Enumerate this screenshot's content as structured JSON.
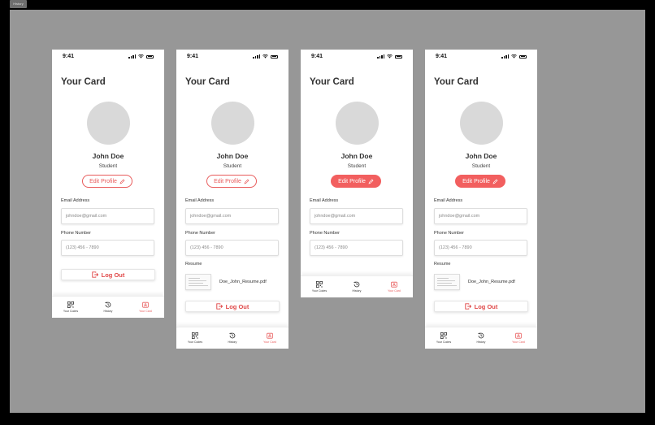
{
  "tab_label": "History",
  "phones": [
    {
      "time": "9:41",
      "title": "Your Card",
      "name": "John Doe",
      "role": "Student",
      "edit_label": "Edit Profile",
      "edit_filled": false,
      "email_label": "Email Address",
      "email_placeholder": "johndoe@gmail.com",
      "phone_label": "Phone Number",
      "phone_placeholder": "(123) 456 - 7890",
      "has_resume": false,
      "logout_label": "Log Out",
      "nav": [
        "Your Codes",
        "History",
        "Your Card"
      ]
    },
    {
      "time": "9:41",
      "title": "Your Card",
      "name": "John Doe",
      "role": "Student",
      "edit_label": "Edit Profile",
      "edit_filled": false,
      "email_label": "Email Address",
      "email_placeholder": "johndoe@gmail.com",
      "phone_label": "Phone Number",
      "phone_placeholder": "(123) 456 - 7890",
      "has_resume": true,
      "resume_label": "Resume",
      "resume_file": "Doe_John_Resume.pdf",
      "logout_label": "Log Out",
      "nav": [
        "Your Codes",
        "History",
        "Your Card"
      ]
    },
    {
      "time": "9:41",
      "title": "Your Card",
      "name": "John Doe",
      "role": "Student",
      "edit_label": "Edit Profile",
      "edit_filled": true,
      "email_label": "Email Address",
      "email_placeholder": "johndoe@gmail.com",
      "phone_label": "Phone Number",
      "phone_placeholder": "(123) 456 - 7890",
      "has_resume": false,
      "nav": [
        "Your Codes",
        "History",
        "Your Card"
      ]
    },
    {
      "time": "9:41",
      "title": "Your Card",
      "name": "John Doe",
      "role": "Student",
      "edit_label": "Edit Profile",
      "edit_filled": true,
      "email_label": "Email Address",
      "email_placeholder": "johndoe@gmail.com",
      "phone_label": "Phone Number",
      "phone_placeholder": "(123) 456 - 7890",
      "has_resume": true,
      "resume_label": "Resume",
      "resume_file": "Doe_John_Resume.pdf",
      "logout_label": "Log Out",
      "nav": [
        "Your Codes",
        "History",
        "Your Card"
      ]
    }
  ],
  "accent_color": "#e85b5b",
  "icons": {
    "nav": [
      "qr-code-icon",
      "history-icon",
      "id-card-icon"
    ],
    "edit": "pencil-icon",
    "logout": "logout-icon"
  }
}
